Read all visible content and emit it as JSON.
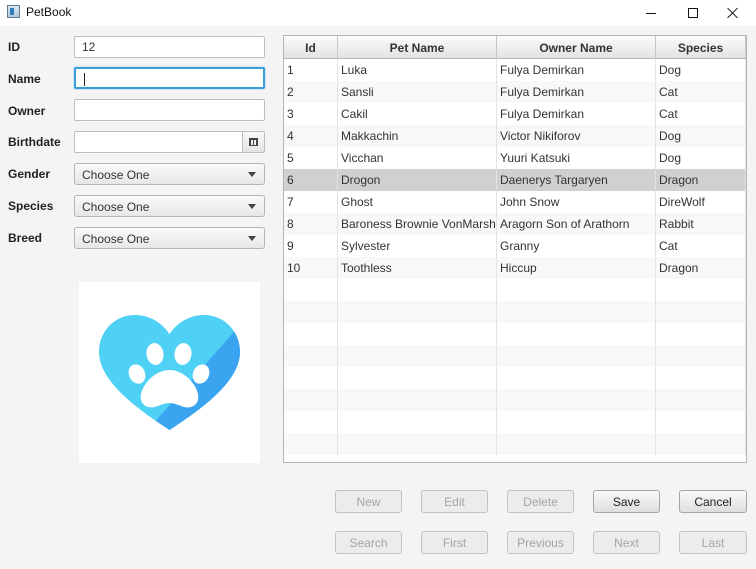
{
  "window": {
    "title": "PetBook",
    "controls": {
      "minimize": "minimize-icon",
      "maximize": "maximize-icon",
      "close": "close-icon"
    }
  },
  "form": {
    "id": {
      "label": "ID",
      "value": "12"
    },
    "name": {
      "label": "Name",
      "value": ""
    },
    "owner": {
      "label": "Owner",
      "value": ""
    },
    "birthdate": {
      "label": "Birthdate",
      "value": ""
    },
    "gender": {
      "label": "Gender",
      "selected": "Choose One"
    },
    "species": {
      "label": "Species",
      "selected": "Choose One"
    },
    "breed": {
      "label": "Breed",
      "selected": "Choose One"
    }
  },
  "logo": {
    "icon": "heart-paw-icon",
    "colors": {
      "light": "#4fd0f5",
      "dark": "#3aa4f0",
      "paw": "#ffffff"
    }
  },
  "table": {
    "columns": [
      "Id",
      "Pet Name",
      "Owner Name",
      "Species"
    ],
    "selected_row": 5,
    "rows": [
      [
        "1",
        "Luka",
        "Fulya Demirkan",
        "Dog"
      ],
      [
        "2",
        "Sansli",
        "Fulya Demirkan",
        "Cat"
      ],
      [
        "3",
        "Cakil",
        "Fulya Demirkan",
        "Cat"
      ],
      [
        "4",
        "Makkachin",
        "Victor Nikiforov",
        "Dog"
      ],
      [
        "5",
        "Vicchan",
        "Yuuri Katsuki",
        "Dog"
      ],
      [
        "6",
        "Drogon",
        "Daenerys Targaryen",
        "Dragon"
      ],
      [
        "7",
        "Ghost",
        "John Snow",
        "DireWolf"
      ],
      [
        "8",
        "Baroness Brownie VonMarsh…",
        "Aragorn Son of Arathorn",
        "Rabbit"
      ],
      [
        "9",
        "Sylvester",
        "Granny",
        "Cat"
      ],
      [
        "10",
        "Toothless",
        "Hiccup",
        "Dragon"
      ]
    ]
  },
  "buttons": {
    "row1": [
      {
        "label": "New",
        "enabled": false
      },
      {
        "label": "Edit",
        "enabled": false
      },
      {
        "label": "Delete",
        "enabled": false
      },
      {
        "label": "Save",
        "enabled": true
      },
      {
        "label": "Cancel",
        "enabled": true
      }
    ],
    "row2": [
      {
        "label": "Search",
        "enabled": false
      },
      {
        "label": "First",
        "enabled": false
      },
      {
        "label": "Previous",
        "enabled": false
      },
      {
        "label": "Next",
        "enabled": false
      },
      {
        "label": "Last",
        "enabled": false
      }
    ]
  }
}
